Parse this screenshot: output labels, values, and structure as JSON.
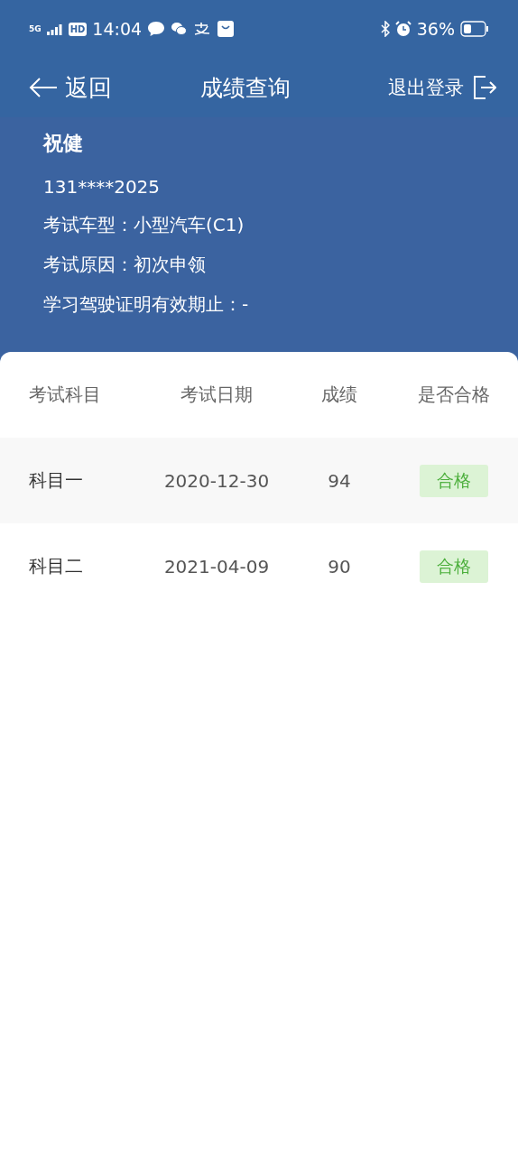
{
  "status_bar": {
    "network": "5G",
    "hd": "HD",
    "time": "14:04",
    "battery": "36%"
  },
  "nav": {
    "back": "返回",
    "title": "成绩查询",
    "logout": "退出登录"
  },
  "profile": {
    "name": "祝健",
    "phone": "131****2025",
    "lines": [
      "考试车型：小型汽车(C1)",
      "考试原因：初次申领",
      "学习驾驶证明有效期止：-"
    ]
  },
  "table": {
    "columns": [
      "考试科目",
      "考试日期",
      "成绩",
      "是否合格"
    ],
    "rows": [
      {
        "subject": "科目一",
        "date": "2020-12-30",
        "score": "94",
        "result": "合格",
        "passed": true
      },
      {
        "subject": "科目二",
        "date": "2021-04-09",
        "score": "90",
        "result": "合格",
        "passed": true
      }
    ]
  }
}
